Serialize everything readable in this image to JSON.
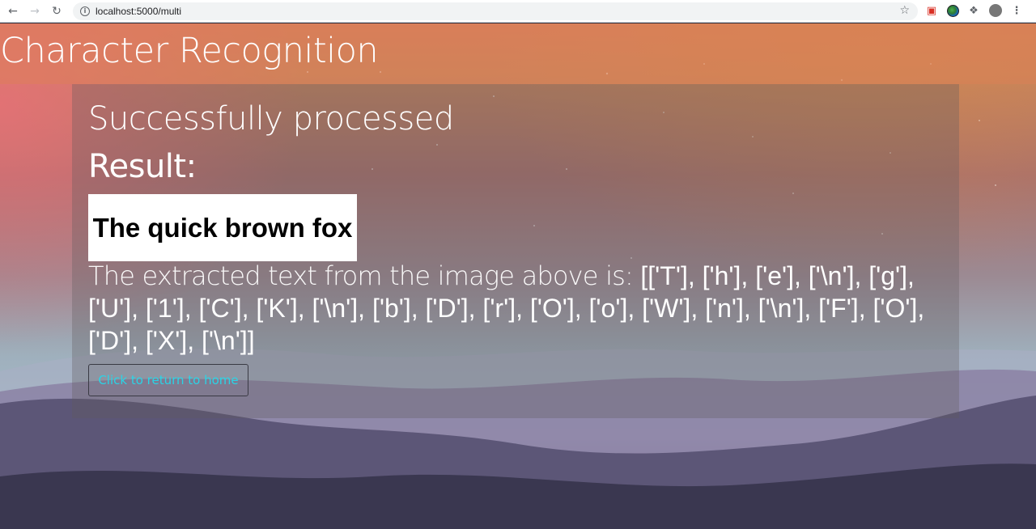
{
  "browser": {
    "url": "localhost:5000/multi",
    "icons": {
      "back": "back-arrow-icon",
      "forward": "forward-arrow-icon",
      "reload": "reload-icon",
      "info": "info-icon",
      "bookmark": "star-icon",
      "extensions": [
        "pdf-extension-icon",
        "globe-extension-icon",
        "puzzle-extensions-icon",
        "profile-avatar-icon",
        "kebab-menu-icon"
      ]
    }
  },
  "header": {
    "title": "Character Recognition"
  },
  "result": {
    "status": "Successfully processed",
    "label": "Result:",
    "image_text": "The quick brown fox",
    "extracted_lead": "The extracted text from the image above is: ",
    "extracted_value": "[['T'], ['h'], ['e'], ['\\n'], ['g'], ['U'], ['1'], ['C'], ['K'], ['\\n'], ['b'], ['D'], ['r'], ['O'], ['o'], ['W'], ['n'], ['\\n'], ['F'], ['O'], ['D'], ['X'], ['\\n']]",
    "home_button": "Click to return to home"
  },
  "colors": {
    "link_accent": "#2ad4e6",
    "header_band": "#de8056"
  }
}
